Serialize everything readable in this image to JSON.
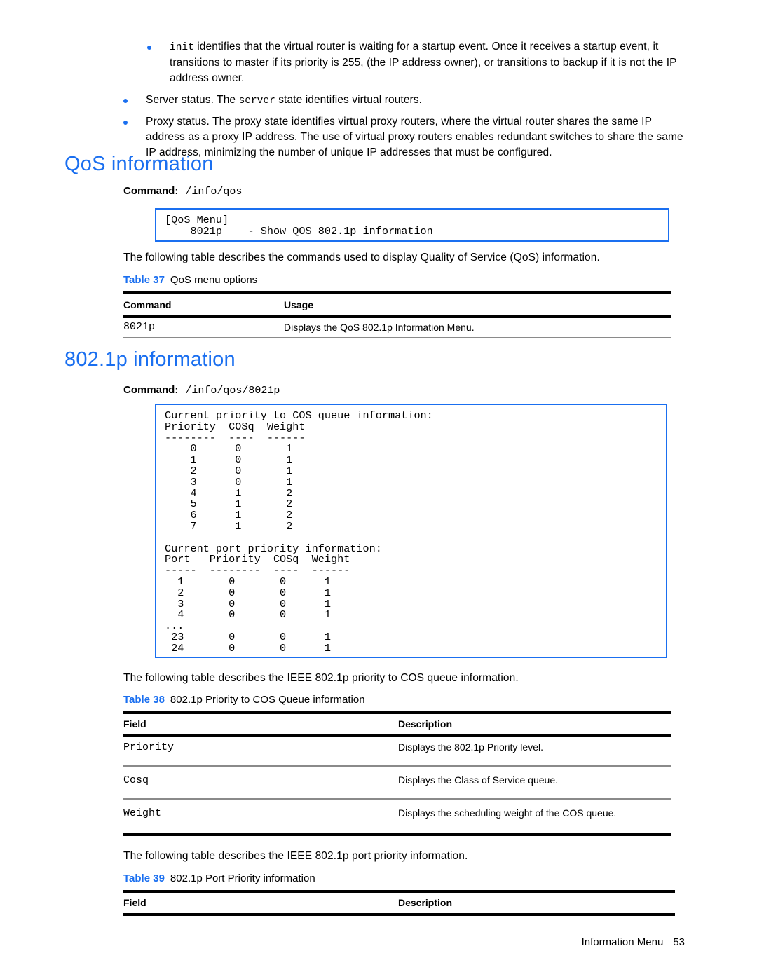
{
  "bullets": [
    {
      "indented": true,
      "segments": [
        {
          "type": "mono",
          "text": "init"
        },
        {
          "type": "text",
          "text": " identifies that the virtual router is waiting for a startup event. Once it receives a startup event, it transitions to master if its priority is 255, (the IP address owner), or transitions to backup if it is not the IP address owner."
        }
      ]
    },
    {
      "indented": false,
      "segments": [
        {
          "type": "text",
          "text": "Server status. The "
        },
        {
          "type": "mono",
          "text": "server"
        },
        {
          "type": "text",
          "text": " state identifies virtual routers."
        }
      ]
    },
    {
      "indented": false,
      "segments": [
        {
          "type": "text",
          "text": "Proxy status. The proxy state identifies virtual proxy routers, where the virtual router shares the same IP address as a proxy IP address. The use of virtual proxy routers enables redundant switches to share the same IP address, minimizing the number of unique IP addresses that must be configured."
        }
      ]
    }
  ],
  "qos_section": {
    "title": "QoS information",
    "command_label": "Command:",
    "command_value": "/info/qos",
    "code": "[QoS Menu]\n    8021p    - Show QOS 802.1p information",
    "intro": "The following table describes the commands used to display Quality of Service (QoS) information.",
    "table": {
      "caption_num": "Table 37",
      "caption_text": "QoS menu options",
      "headers": [
        "Command",
        "Usage"
      ],
      "rows": [
        {
          "field": "8021p",
          "description": "Displays the QoS 802.1p Information Menu."
        }
      ]
    }
  },
  "dot1p_section": {
    "title": "802.1p information",
    "command_label": "Command:",
    "command_value": "/info/qos/8021p",
    "code": "Current priority to COS queue information:\nPriority  COSq  Weight\n--------  ----  ------\n    0      0       1\n    1      0       1\n    2      0       1\n    3      0       1\n    4      1       2\n    5      1       2\n    6      1       2\n    7      1       2\n\nCurrent port priority information:\nPort   Priority  COSq  Weight\n-----  --------  ----  ------\n  1       0       0      1\n  2       0       0      1\n  3       0       0      1\n  4       0       0      1\n...\n 23       0       0      1\n 24       0       0      1",
    "intro_38": "The following table describes the IEEE 802.1p priority to COS queue information.",
    "table_38": {
      "caption_num": "Table 38",
      "caption_text": "802.1p Priority to COS Queue information",
      "headers": [
        "Field",
        "Description"
      ],
      "rows": [
        {
          "field": "Priority",
          "description": "Displays the 802.1p Priority level."
        },
        {
          "field": "Cosq",
          "description": "Displays the Class of Service queue."
        },
        {
          "field": "Weight",
          "description": "Displays the scheduling weight of the COS queue."
        }
      ]
    },
    "intro_39": "The following table describes the IEEE 802.1p port priority information.",
    "table_39": {
      "caption_num": "Table 39",
      "caption_text": "802.1p Port Priority information",
      "headers": [
        "Field",
        "Description"
      ],
      "rows": []
    }
  },
  "footer": {
    "label": "Information Menu",
    "page_number": "53"
  },
  "colors": {
    "accent_blue": "#1a6ff0",
    "rule_black": "#000000",
    "rule_gray": "#8a8a8a"
  }
}
